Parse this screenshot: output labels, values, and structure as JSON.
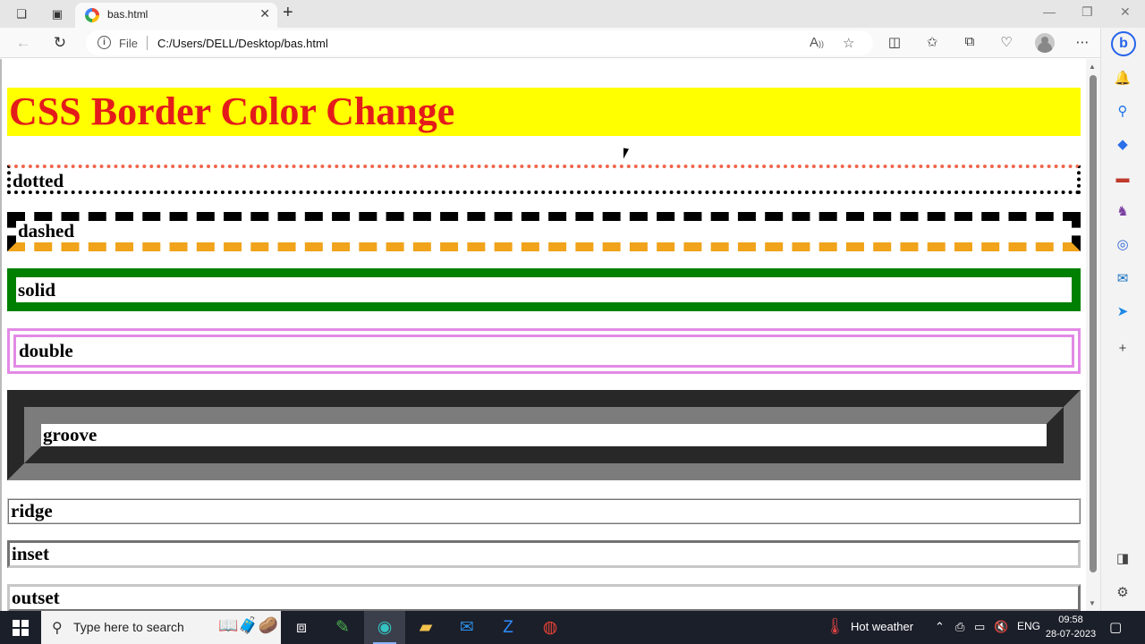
{
  "browser": {
    "tab": {
      "title": "bas.html",
      "close_glyph": "✕"
    },
    "new_tab_glyph": "+",
    "window_controls": {
      "minimize": "—",
      "restore": "❐",
      "close": "✕"
    },
    "address": {
      "scheme_label": "File",
      "url": "C:/Users/DELL/Desktop/bas.html"
    }
  },
  "page": {
    "heading": "CSS Border Color Change",
    "boxes": {
      "dotted": "dotted",
      "dashed": "dashed",
      "solid": "solid",
      "double": "double",
      "groove": "groove",
      "ridge": "ridge",
      "inset": "inset",
      "outset": "outset"
    },
    "colors": {
      "heading_background": "#ffff00",
      "heading_text": "#e41b1b",
      "dotted_top": "#f0664b",
      "dashed_bottom": "#f0a31b",
      "solid": "#008000",
      "double": "#e28ae6",
      "groove": "#7c7c7c"
    }
  },
  "taskbar": {
    "search_placeholder": "Type here to search",
    "weather": "Hot weather",
    "language": "ENG",
    "time": "09:58",
    "date": "28-07-2023"
  }
}
